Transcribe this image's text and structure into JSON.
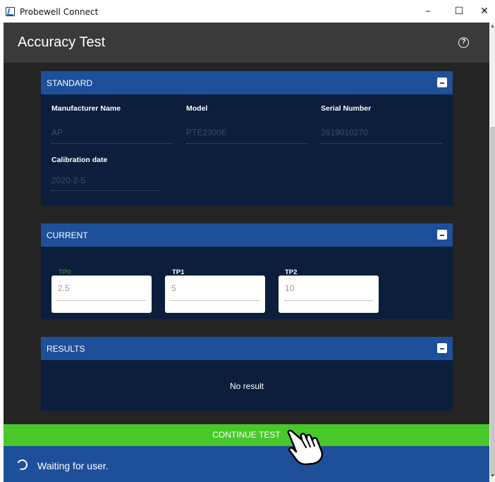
{
  "window": {
    "title": "Probewell Connect",
    "minimize": "–",
    "maximize": "☐",
    "close": "✕"
  },
  "header": {
    "title": "Accuracy Test",
    "help_icon": "?"
  },
  "standard": {
    "title": "STANDARD",
    "manufacturer_label": "Manufacturer Name",
    "manufacturer_value": "AP",
    "model_label": "Model",
    "model_value": "PTE2300E",
    "serial_label": "Serial Number",
    "serial_value": "2619010270",
    "calibration_label": "Calibration date",
    "calibration_value": "2020-2-5"
  },
  "current": {
    "title": "CURRENT",
    "points": [
      {
        "label": "TP0",
        "value": "2.5"
      },
      {
        "label": "TP1",
        "value": "5"
      },
      {
        "label": "TP2",
        "value": "10"
      }
    ]
  },
  "results": {
    "title": "RESULTS",
    "empty_text": "No result"
  },
  "actions": {
    "continue_label": "CONTINUE TEST"
  },
  "status": {
    "text": "Waiting for user."
  },
  "colors": {
    "header_blue": "#1e4f9a",
    "card_bg": "#0c1e3c",
    "continue_green": "#49c82c",
    "app_bg": "#242424"
  }
}
